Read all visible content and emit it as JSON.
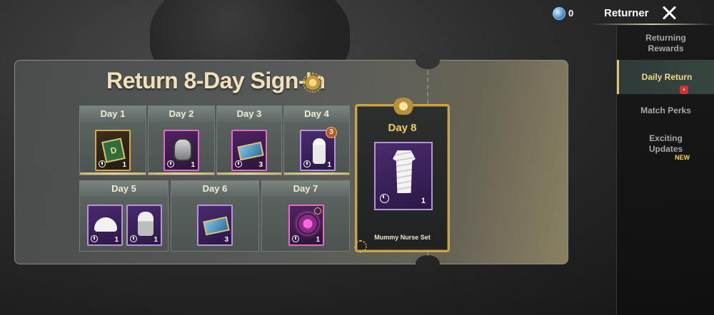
{
  "header": {
    "currency_count": "0",
    "title": "Returner",
    "icons": {
      "currency": "coin-icon",
      "close": "close-icon"
    }
  },
  "sidebar": {
    "items": [
      {
        "label": "Returning Rewards",
        "active": false
      },
      {
        "label": "Daily Return",
        "active": true
      },
      {
        "label": "Match Perks",
        "active": false
      },
      {
        "label": "Exciting Updates",
        "active": false
      }
    ],
    "new_tag": "NEW"
  },
  "panel": {
    "title": "Return 8-Day Sign-In",
    "days": [
      {
        "label": "Day 1",
        "rewards": [
          {
            "icon": "card-icon",
            "qty": "1"
          }
        ]
      },
      {
        "label": "Day 2",
        "rewards": [
          {
            "icon": "helmet-icon",
            "qty": "1"
          }
        ]
      },
      {
        "label": "Day 3",
        "rewards": [
          {
            "icon": "ticket-icon",
            "qty": "3"
          }
        ]
      },
      {
        "label": "Day 4",
        "rewards": [
          {
            "icon": "emote-icon",
            "qty": "1",
            "badge": "3"
          }
        ]
      },
      {
        "label": "Day 5",
        "rewards": [
          {
            "icon": "hat-icon",
            "qty": "1"
          },
          {
            "icon": "head-icon",
            "qty": "1"
          }
        ]
      },
      {
        "label": "Day 6",
        "rewards": [
          {
            "icon": "ticket-icon",
            "qty": "3"
          }
        ]
      },
      {
        "label": "Day 7",
        "rewards": [
          {
            "icon": "gear-icon",
            "qty": "1"
          }
        ]
      }
    ],
    "grand": {
      "label": "Day 8",
      "item_name": "Mummy Nurse Set",
      "qty": "1",
      "icon": "outfit-icon"
    }
  },
  "colors": {
    "accent_gold": "#f2cf5d",
    "title_cream": "#f7e7bd",
    "item_purple_border": "#b893d8"
  }
}
